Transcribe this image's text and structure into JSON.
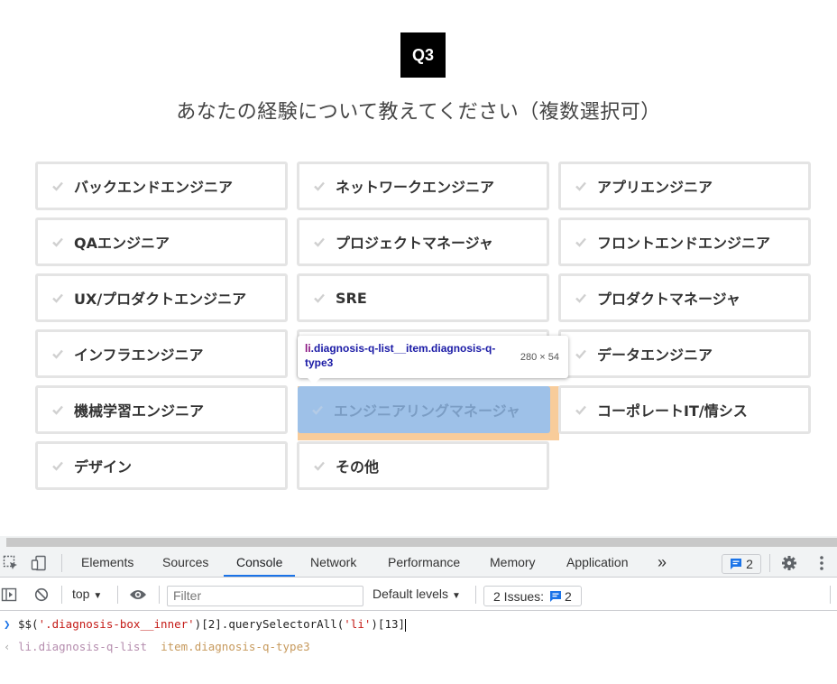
{
  "question": {
    "badge": "Q3",
    "title": "あなたの経験について教えてください（複数選択可）"
  },
  "options": [
    {
      "label": "バックエンドエンジニア"
    },
    {
      "label": "ネットワークエンジニア"
    },
    {
      "label": "アプリエンジニア"
    },
    {
      "label": "QAエンジニア"
    },
    {
      "label": "プロジェクトマネージャ"
    },
    {
      "label": "フロントエンドエンジニア"
    },
    {
      "label": "UX/プロダクトエンジニア"
    },
    {
      "label": "SRE"
    },
    {
      "label": "プロダクトマネージャ"
    },
    {
      "label": "インフラエンジニア"
    },
    {
      "label": "データエンジニア"
    },
    {
      "label": "機械学習エンジニア"
    },
    {
      "label": "エンジニアリングマネージャ"
    },
    {
      "label": "コーポレートIT/情シス"
    },
    {
      "label": "デザイン"
    },
    {
      "label": "その他"
    }
  ],
  "inspect_tooltip": {
    "tag": "li",
    "classes": ".diagnosis-q-list__item.diagnosis-q-type3",
    "dimensions": "280 × 54"
  },
  "colors": {
    "highlight_content": "#9ec1e8",
    "highlight_margin": "#f8cc9a",
    "check": "#d0d0d0",
    "border": "#e4e4e4",
    "devtools_accent": "#1a73e8"
  },
  "devtools": {
    "tabs": [
      {
        "label": "Elements"
      },
      {
        "label": "Sources"
      },
      {
        "label": "Console",
        "active": true
      },
      {
        "label": "Network"
      },
      {
        "label": "Performance"
      },
      {
        "label": "Memory"
      },
      {
        "label": "Application"
      }
    ],
    "more_tabs": "»",
    "message_count": "2",
    "toolbar": {
      "context": "top",
      "filter_placeholder": "Filter",
      "levels": "Default levels",
      "issues_label": "2 Issues:",
      "issues_count": "2"
    },
    "console": {
      "input_prefix": "$$(",
      "input_string": "'.diagnosis-box__inner'",
      "input_mid1": ")[",
      "input_index1": "2",
      "input_mid2": "].querySelectorAll(",
      "input_string2": "'li'",
      "input_mid3": ")[",
      "input_index2": "13",
      "input_end": "]",
      "output_tag": "li.diagnosis-q-list",
      "output_rest": "item.diagnosis-q-type3"
    }
  }
}
